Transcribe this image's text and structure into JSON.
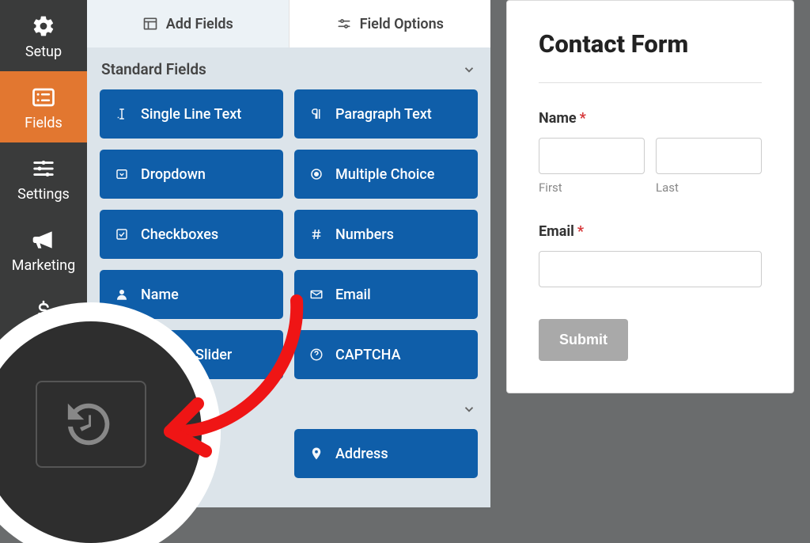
{
  "sidebar": {
    "items": [
      {
        "label": "Setup"
      },
      {
        "label": "Fields"
      },
      {
        "label": "Settings"
      },
      {
        "label": "Marketing"
      },
      {
        "label": "Payments"
      }
    ]
  },
  "tabs": {
    "add_fields": "Add Fields",
    "field_options": "Field Options"
  },
  "sections": {
    "standard": {
      "title": "Standard Fields"
    }
  },
  "standard_fields": [
    {
      "label": "Single Line Text"
    },
    {
      "label": "Paragraph Text"
    },
    {
      "label": "Dropdown"
    },
    {
      "label": "Multiple Choice"
    },
    {
      "label": "Checkboxes"
    },
    {
      "label": "Numbers"
    },
    {
      "label": "Name"
    },
    {
      "label": "Email"
    },
    {
      "label": "Number Slider"
    },
    {
      "label": "CAPTCHA"
    }
  ],
  "extra_fields": [
    {
      "label": "Address"
    }
  ],
  "preview": {
    "form_title": "Contact Form",
    "name_label": "Name",
    "first_sub": "First",
    "last_sub": "Last",
    "email_label": "Email",
    "submit": "Submit",
    "required_mark": "*"
  }
}
